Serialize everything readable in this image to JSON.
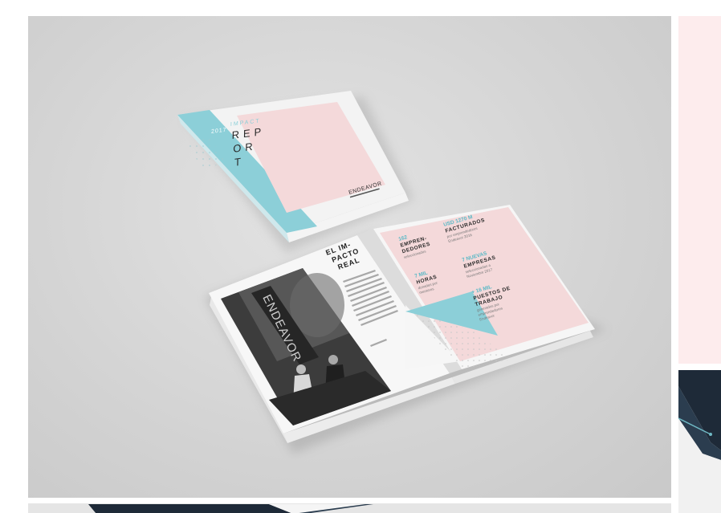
{
  "closed_book": {
    "year": "2017",
    "impact": "IMPACT",
    "title_lines": [
      "REP",
      "OR",
      "T"
    ],
    "brand": "ENDEAVOR"
  },
  "open_book": {
    "heading_lines": [
      "EL IM-",
      "PACTO",
      "REAL"
    ],
    "banner_text": "ENDEAVOR",
    "stats": [
      {
        "lines": [
          "162",
          "EMPREN-",
          "DEDORES",
          "seleccionados"
        ]
      },
      {
        "lines": [
          "USD 1270 M",
          "FACTURADOS",
          "por emprendedores",
          "Endeavor 2016"
        ]
      },
      {
        "lines": [
          "7 MIL",
          "HORAS",
          "donadas por",
          "mentores"
        ]
      },
      {
        "lines": [
          "7 NUEVAS",
          "EMPRESAS",
          "seleccionadas a",
          "Noviembre 2017"
        ]
      },
      {
        "lines": [
          "+ 16 MIL",
          "PUESTOS DE",
          "TRABAJO",
          "generados por",
          "emprendedores",
          "Endeavor"
        ]
      }
    ]
  },
  "colors": {
    "teal": "#8ccfd8",
    "pink": "#f4d9da",
    "side_pink": "#fdeced",
    "navy": "#1e2a38"
  }
}
